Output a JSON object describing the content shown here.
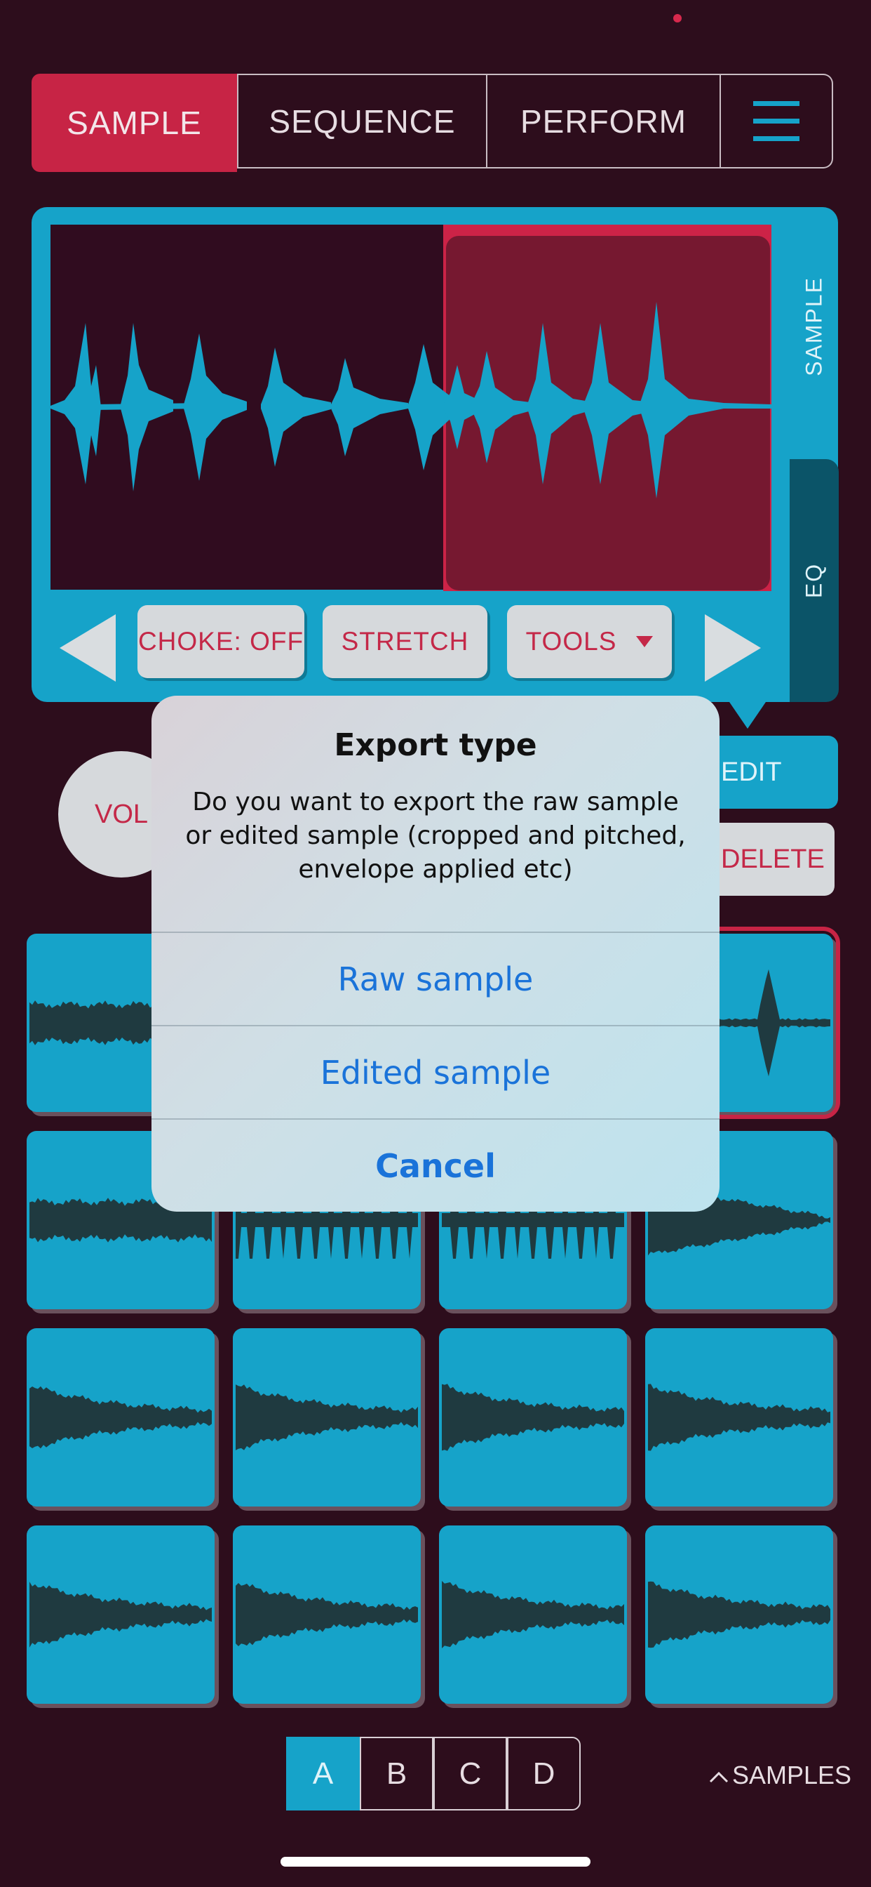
{
  "tabs": {
    "sample": "SAMPLE",
    "sequence": "SEQUENCE",
    "perform": "PERFORM",
    "menu_icon": "hamburger-menu-icon"
  },
  "sample_panel": {
    "side_tabs": [
      "SAMPLE",
      "EQ"
    ],
    "buttons": {
      "choke": "CHOKE: OFF",
      "stretch": "STRETCH",
      "tools": "TOOLS"
    },
    "icons": [
      "arrow-left-icon",
      "arrow-right-icon",
      "dropdown-triangle-icon"
    ]
  },
  "controls": {
    "vol": "VOL",
    "edit": "EDIT",
    "delete": "DELETE"
  },
  "pads": {
    "count": 16,
    "selected_index": 3
  },
  "banks": {
    "items": [
      "A",
      "B",
      "C",
      "D"
    ],
    "active": "A"
  },
  "footer": {
    "samples_link": "SAMPLES",
    "chevron_icon": "chevron-up-icon"
  },
  "dialog": {
    "title": "Export type",
    "message": "Do you want to export the raw sample or edited sample (cropped and pitched, envelope applied etc)",
    "actions": {
      "raw": "Raw sample",
      "edited": "Edited sample",
      "cancel": "Cancel"
    }
  },
  "colors": {
    "background": "#2d0d1c",
    "accent_red": "#c72445",
    "accent_blue": "#16a3c9",
    "dialog_blue": "#1a73d9"
  }
}
